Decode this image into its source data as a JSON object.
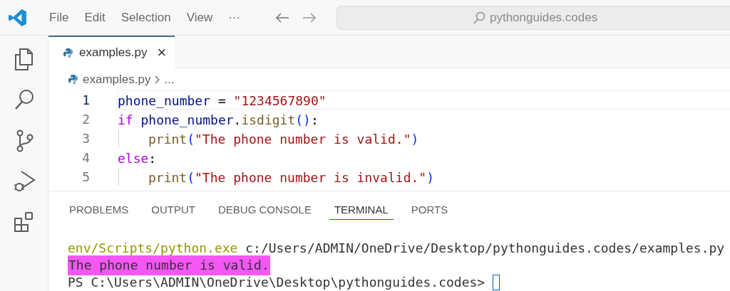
{
  "menu": [
    "File",
    "Edit",
    "Selection",
    "View",
    "···"
  ],
  "command_center": {
    "text": "pythonguides.codes"
  },
  "activity_bar": [
    {
      "kind": "files",
      "selected": false
    },
    {
      "kind": "search",
      "selected": false
    },
    {
      "kind": "scm",
      "selected": false
    },
    {
      "kind": "debug",
      "selected": false
    },
    {
      "kind": "extensions",
      "selected": false
    }
  ],
  "tabs": [
    {
      "label": "examples.py",
      "selected": true,
      "close": "×"
    }
  ],
  "breadcrumb": [
    "examples.py",
    "..."
  ],
  "code": [
    {
      "number": "1",
      "current": true,
      "indented": false,
      "tokens": [
        {
          "kind": "var",
          "text": "phone_number"
        },
        {
          "kind": "plain",
          "text": " = "
        },
        {
          "kind": "string",
          "text": "\"1234567890\""
        }
      ]
    },
    {
      "number": "2",
      "current": false,
      "indented": false,
      "tokens": [
        {
          "kind": "keyword",
          "text": "if"
        },
        {
          "kind": "var",
          "text": " phone_number"
        },
        {
          "kind": "plain",
          "text": "."
        },
        {
          "kind": "func",
          "text": "isdigit"
        },
        {
          "kind": "paren",
          "text": "()"
        },
        {
          "kind": "plain",
          "text": ":"
        }
      ]
    },
    {
      "number": "3",
      "current": false,
      "indented": true,
      "tokens": [
        {
          "kind": "func",
          "text": "print"
        },
        {
          "kind": "paren",
          "text": "("
        },
        {
          "kind": "string",
          "text": "\"The phone number is valid.\""
        },
        {
          "kind": "paren",
          "text": ")"
        }
      ]
    },
    {
      "number": "4",
      "current": false,
      "indented": false,
      "tokens": [
        {
          "kind": "keyword",
          "text": "else"
        },
        {
          "kind": "plain",
          "text": ":"
        }
      ]
    },
    {
      "number": "5",
      "current": false,
      "indented": true,
      "tokens": [
        {
          "kind": "func",
          "text": "print"
        },
        {
          "kind": "paren",
          "text": "("
        },
        {
          "kind": "string",
          "text": "\"The phone number is invalid.\""
        },
        {
          "kind": "paren",
          "text": ")"
        }
      ]
    }
  ],
  "panel_tabs": [
    {
      "label": "PROBLEMS",
      "selected": false
    },
    {
      "label": "OUTPUT",
      "selected": false
    },
    {
      "label": "DEBUG CONSOLE",
      "selected": false
    },
    {
      "label": "TERMINAL",
      "selected": true
    },
    {
      "label": "PORTS",
      "selected": false
    }
  ],
  "terminal": [
    {
      "highlighted": false,
      "cursor": false,
      "tokens": [
        {
          "kind": "path",
          "text": "env/Scripts/python.exe"
        },
        {
          "kind": "plain",
          "text": " c:/Users/ADMIN/OneDrive/Desktop/pythonguides.codes/examples.py"
        }
      ]
    },
    {
      "highlighted": true,
      "cursor": false,
      "tokens": [
        {
          "kind": "plain",
          "text": "The phone number is valid."
        }
      ]
    },
    {
      "highlighted": false,
      "cursor": true,
      "tokens": [
        {
          "kind": "plain",
          "text": "PS C:\\Users\\ADMIN\\OneDrive\\Desktop\\pythonguides.codes> "
        }
      ]
    }
  ]
}
